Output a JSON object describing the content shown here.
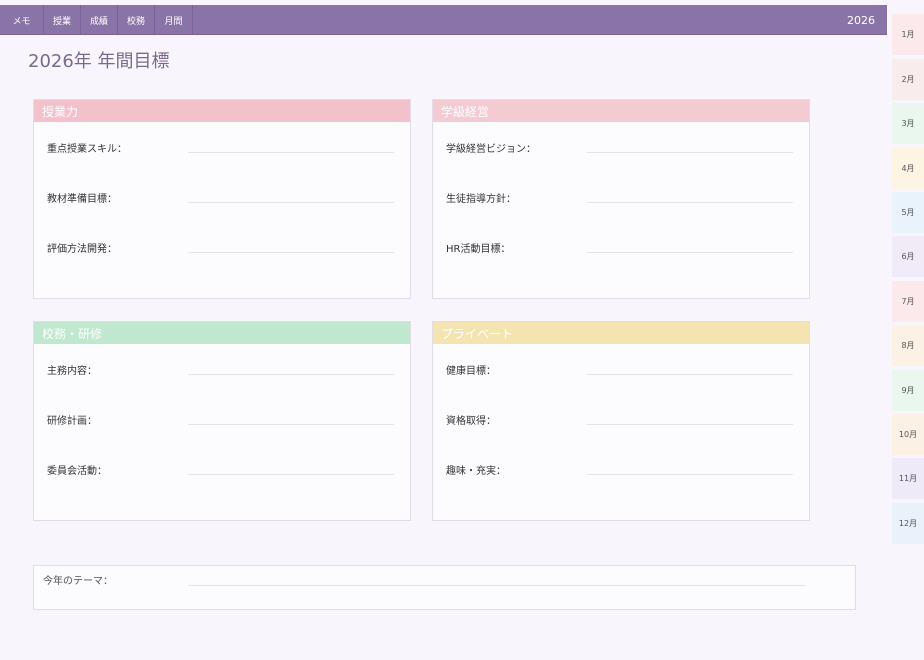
{
  "nav": {
    "items": [
      {
        "label": "メモ"
      },
      {
        "label": "授業"
      },
      {
        "label": "成績"
      },
      {
        "label": "校務"
      },
      {
        "label": "月間"
      }
    ],
    "year": "2026"
  },
  "page": {
    "title": "2026年 年間目標"
  },
  "cards": [
    {
      "title": "授業力",
      "color": "#f2c1cc",
      "fields": [
        {
          "label": "重点授業スキル："
        },
        {
          "label": "教材準備目標："
        },
        {
          "label": "評価方法開発："
        }
      ]
    },
    {
      "title": "学級経営",
      "color": "#f4cbd2",
      "fields": [
        {
          "label": "学級経営ビジョン："
        },
        {
          "label": "生徒指導方針："
        },
        {
          "label": "HR活動目標："
        }
      ]
    },
    {
      "title": "校務・研修",
      "color": "#bfe8cf",
      "fields": [
        {
          "label": "主務内容："
        },
        {
          "label": "研修計画："
        },
        {
          "label": "委員会活動："
        }
      ]
    },
    {
      "title": "プライベート",
      "color": "#f3e4b1",
      "fields": [
        {
          "label": "健康目標："
        },
        {
          "label": "資格取得："
        },
        {
          "label": "趣味・充実："
        }
      ]
    }
  ],
  "theme": {
    "label": "今年のテーマ："
  },
  "month_tabs": [
    {
      "label": "1月",
      "color": "#fbe9ec"
    },
    {
      "label": "2月",
      "color": "#f9ecec"
    },
    {
      "label": "3月",
      "color": "#eaf7ee"
    },
    {
      "label": "4月",
      "color": "#fcf5e4"
    },
    {
      "label": "5月",
      "color": "#e9f3fb"
    },
    {
      "label": "6月",
      "color": "#f1ebf8"
    },
    {
      "label": "7月",
      "color": "#fbe9ec"
    },
    {
      "label": "8月",
      "color": "#fcf1e5"
    },
    {
      "label": "9月",
      "color": "#eaf7ee"
    },
    {
      "label": "10月",
      "color": "#fcf1e5"
    },
    {
      "label": "11月",
      "color": "#efeaf8"
    },
    {
      "label": "12月",
      "color": "#e9f1fb"
    }
  ]
}
